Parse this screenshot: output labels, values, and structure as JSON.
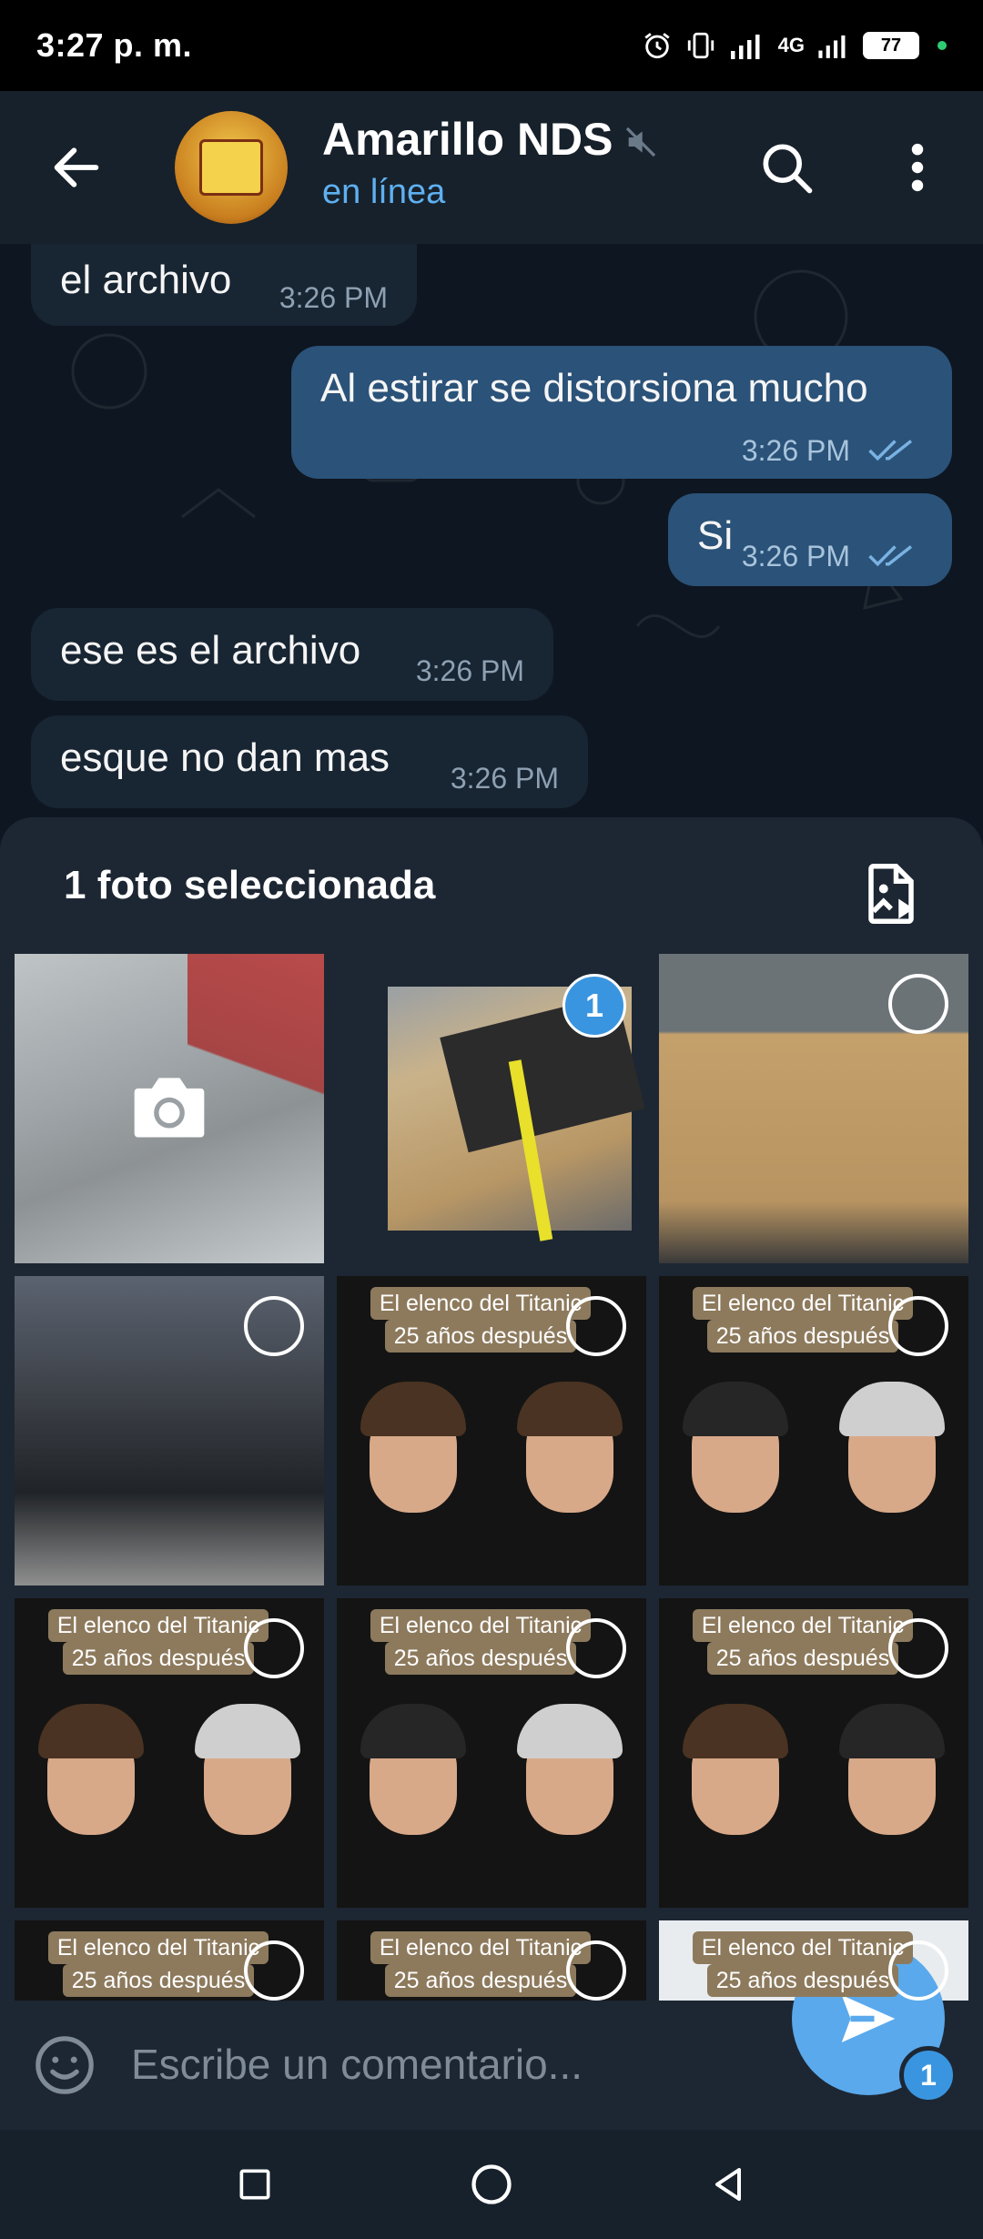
{
  "status_bar": {
    "time": "3:27 p. m.",
    "network": "4G",
    "battery": "77"
  },
  "header": {
    "title": "Amarillo NDS",
    "status": "en línea",
    "accent_color": "#5fb0f0"
  },
  "messages": [
    {
      "direction": "in",
      "text": "el archivo",
      "time": "3:26 PM"
    },
    {
      "direction": "out",
      "text": "Al estirar se distorsiona mucho",
      "time": "3:26 PM",
      "read": true
    },
    {
      "direction": "out",
      "text": "Si",
      "time": "3:26 PM",
      "read": true
    },
    {
      "direction": "in",
      "text": "ese es el archivo",
      "time": "3:26 PM"
    },
    {
      "direction": "in",
      "text": "esque no dan mas",
      "time": "3:26 PM"
    }
  ],
  "attach_sheet": {
    "title": "1 foto seleccionada",
    "photos": [
      {
        "kind": "camera",
        "icon": "camera-icon"
      },
      {
        "kind": "photo",
        "selected_index": "1"
      },
      {
        "kind": "photo"
      },
      {
        "kind": "photo"
      },
      {
        "kind": "photo",
        "line1": "El elenco del Titanic",
        "line2": "25 años después"
      },
      {
        "kind": "photo",
        "line1": "El elenco del Titanic",
        "line2": "25 años después"
      },
      {
        "kind": "photo",
        "line1": "El elenco del Titanic",
        "line2": "25 años después"
      },
      {
        "kind": "photo",
        "line1": "El elenco del Titanic",
        "line2": "25 años después"
      },
      {
        "kind": "photo",
        "line1": "El elenco del Titanic",
        "line2": "25 años después"
      },
      {
        "kind": "photo",
        "line1": "El elenco del Titanic",
        "line2": "25 años después"
      },
      {
        "kind": "photo",
        "line1": "El elenco del Titanic",
        "line2": "25 años después"
      },
      {
        "kind": "photo",
        "line1": "El elenco del Titanic",
        "line2": "25 años después"
      }
    ]
  },
  "composer": {
    "placeholder": "Escribe un comentario...",
    "send_count": "1"
  }
}
